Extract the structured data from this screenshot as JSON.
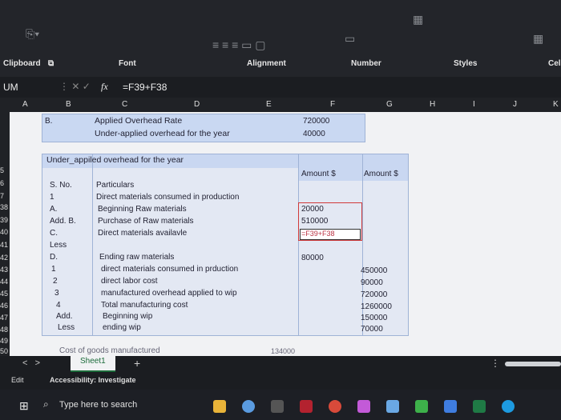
{
  "ribbon": {
    "clipboard": "Clipboard",
    "font": "Font",
    "alignment": "Alignment",
    "number": "Number",
    "styles": "Styles",
    "cells": "Cell"
  },
  "formula": {
    "namebox": "UM",
    "fx": "fx",
    "value": "=F39+F38"
  },
  "columns": [
    "A",
    "B",
    "C",
    "D",
    "E",
    "F",
    "G",
    "H",
    "I",
    "J",
    "K"
  ],
  "rows": [
    "5",
    "6",
    "7",
    "38",
    "39",
    "40",
    "41",
    "42",
    "43",
    "44",
    "45",
    "46",
    "47",
    "48",
    "49",
    "50"
  ],
  "top": {
    "b": "B.",
    "l1": "Applied Overhead Rate",
    "l2": "Under-applied overhead for the year",
    "v1": "720000",
    "v2": "40000"
  },
  "title": "Under_appiled overhead for the year",
  "hdr": {
    "f": "Amount $",
    "g": "Amount $"
  },
  "table": [
    {
      "a": "S. No.",
      "b": "Particulars",
      "f": "",
      "g": ""
    },
    {
      "a": "1",
      "b": "Direct materials consumed in production",
      "f": "",
      "g": ""
    },
    {
      "a": "A.",
      "b": "Beginning Raw materials",
      "f": "20000",
      "g": ""
    },
    {
      "a": "Add. B.",
      "b": "Purchase of Raw materials",
      "f": "510000",
      "g": ""
    },
    {
      "a": "C.",
      "b": "Direct materials availavle",
      "f": "=F39+F38",
      "g": ""
    },
    {
      "a": "Less",
      "b": "",
      "f": "",
      "g": ""
    },
    {
      "a": "D.",
      "b": "Ending raw materials",
      "f": "80000",
      "g": ""
    },
    {
      "a": "1",
      "b": "direct materials consumed in prduction",
      "f": "",
      "g": "450000"
    },
    {
      "a": "2",
      "b": "direct labor cost",
      "f": "",
      "g": "90000"
    },
    {
      "a": "3",
      "b": "manufactured overhead applied to wip",
      "f": "",
      "g": "720000"
    },
    {
      "a": "4",
      "b": "Total manufacturing cost",
      "f": "",
      "g": "1260000"
    },
    {
      "a": "Add.",
      "b": "Beginning wip",
      "f": "",
      "g": "150000"
    },
    {
      "a": "Less",
      "b": "ending wip",
      "f": "",
      "g": "70000"
    }
  ],
  "last": {
    "b": "Cost of goods manufactured",
    "f": "134000"
  },
  "sheet_tab": "Sheet1",
  "status": {
    "mode": "Edit",
    "access": "Accessibility: Investigate"
  },
  "search": "Type here to search"
}
